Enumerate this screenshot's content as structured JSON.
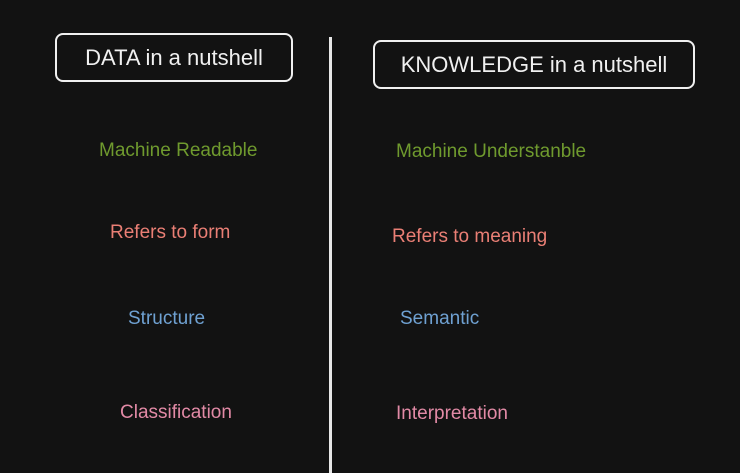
{
  "left": {
    "title": "DATA in a nutshell",
    "items": [
      "Machine Readable",
      "Refers to form",
      "Structure",
      "Classification"
    ]
  },
  "right": {
    "title": "KNOWLEDGE in a nutshell",
    "items": [
      "Machine Understanble",
      "Refers to meaning",
      "Semantic",
      "Interpretation"
    ]
  },
  "colors": {
    "background": "#121212",
    "title": "#f0f0f0",
    "divider": "#e6e6e6",
    "row1": "#6f9a2e",
    "row2": "#ea7f75",
    "row3": "#6fa1d2",
    "row4": "#e28aa6"
  }
}
